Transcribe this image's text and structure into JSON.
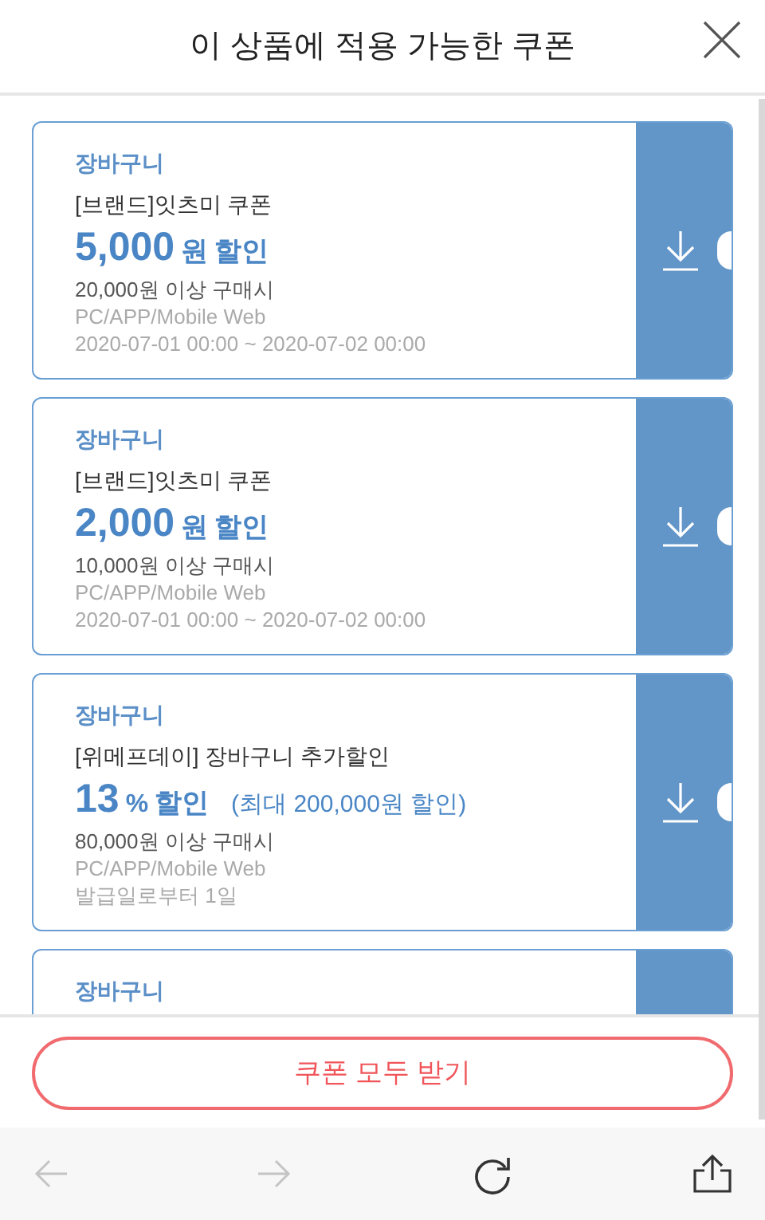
{
  "header": {
    "title": "이 상품에 적용 가능한 쿠폰"
  },
  "coupons": [
    {
      "category": "장바구니",
      "name": "[브랜드]잇츠미 쿠폰",
      "amount": "5,000",
      "unit": "원",
      "suffix": "할인",
      "condition": "20,000원 이상 구매시",
      "platforms": "PC/APP/Mobile Web",
      "validity": "2020-07-01 00:00 ~ 2020-07-02 00:00"
    },
    {
      "category": "장바구니",
      "name": "[브랜드]잇츠미 쿠폰",
      "amount": "2,000",
      "unit": "원",
      "suffix": "할인",
      "condition": "10,000원 이상 구매시",
      "platforms": "PC/APP/Mobile Web",
      "validity": "2020-07-01 00:00 ~ 2020-07-02 00:00"
    },
    {
      "category": "장바구니",
      "name": "[위메프데이] 장바구니 추가할인",
      "amount": "13",
      "unit": "%",
      "suffix": "할인",
      "note": "(최대 200,000원 할인)",
      "condition": "80,000원 이상 구매시",
      "platforms": "PC/APP/Mobile Web",
      "validity": "발급일로부터 1일"
    },
    {
      "category": "장바구니"
    }
  ],
  "download_all_button": "쿠폰 모두 받기",
  "browser_toolbar": [
    {
      "kind": "back",
      "disabled": true
    },
    {
      "kind": "forward",
      "disabled": true
    },
    {
      "kind": "reload",
      "disabled": false
    },
    {
      "kind": "share",
      "disabled": false
    }
  ]
}
